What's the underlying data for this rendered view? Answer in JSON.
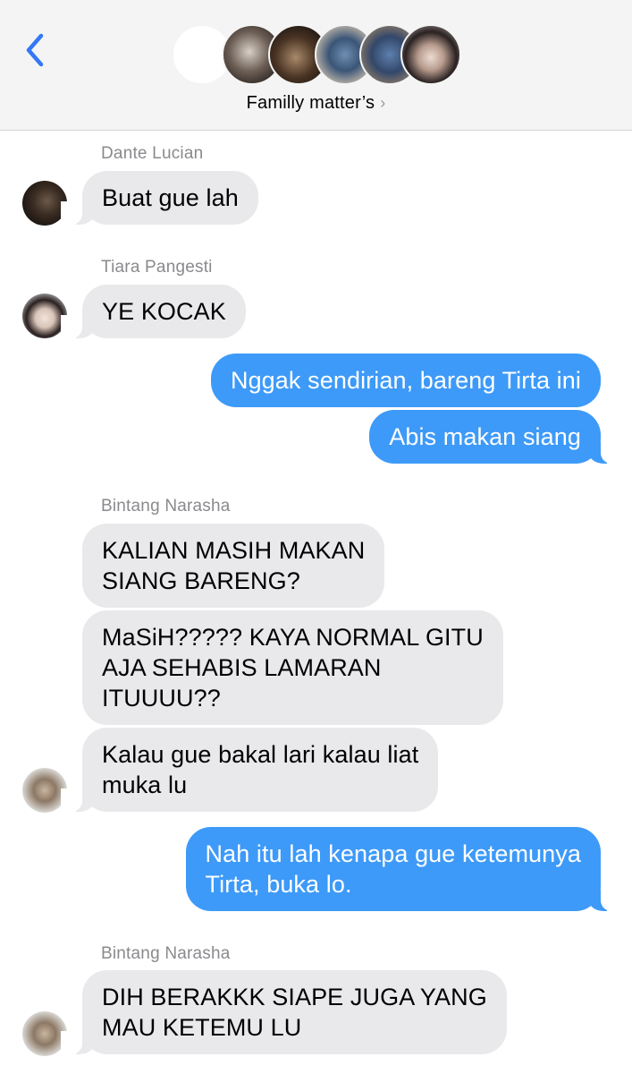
{
  "header": {
    "back_icon": "chevron-left-icon",
    "group_name": "Familly matter’s",
    "chevron": "›",
    "accent_color": "#3478f6",
    "participants": [
      {
        "avatar": "blank"
      },
      {
        "avatar": "photo"
      },
      {
        "avatar": "photo"
      },
      {
        "avatar": "photo"
      },
      {
        "avatar": "photo"
      },
      {
        "avatar": "photo"
      }
    ]
  },
  "colors": {
    "incoming_bubble": "#e9e9eb",
    "outgoing_bubble": "#3d9af8",
    "sender_label": "#8a8a8e"
  },
  "messages": [
    {
      "sender": "Dante Lucian",
      "direction": "in",
      "text": "Buat gue lah"
    },
    {
      "sender": "Tiara Pangesti",
      "direction": "in",
      "text": "YE KOCAK"
    },
    {
      "direction": "out",
      "text": "Nggak sendirian, bareng Tirta ini"
    },
    {
      "direction": "out",
      "text": "Abis makan siang"
    },
    {
      "sender": "Bintang Narasha",
      "direction": "in",
      "lines": [
        "KALIAN MASIH MAKAN",
        "SIANG BARENG?"
      ]
    },
    {
      "direction": "in",
      "lines": [
        "MaSiH????? KAYA NORMAL GITU",
        "AJA SEHABIS LAMARAN",
        "ITUUUU??"
      ]
    },
    {
      "direction": "in",
      "lines": [
        "Kalau gue bakal lari kalau liat",
        "muka lu"
      ]
    },
    {
      "direction": "out",
      "lines": [
        "Nah itu lah kenapa gue ketemunya",
        "Tirta, buka lo."
      ]
    },
    {
      "sender": "Bintang Narasha",
      "direction": "in",
      "lines": [
        "DIH BERAKKK SIAPE JUGA YANG",
        "MAU KETEMU LU"
      ]
    }
  ]
}
